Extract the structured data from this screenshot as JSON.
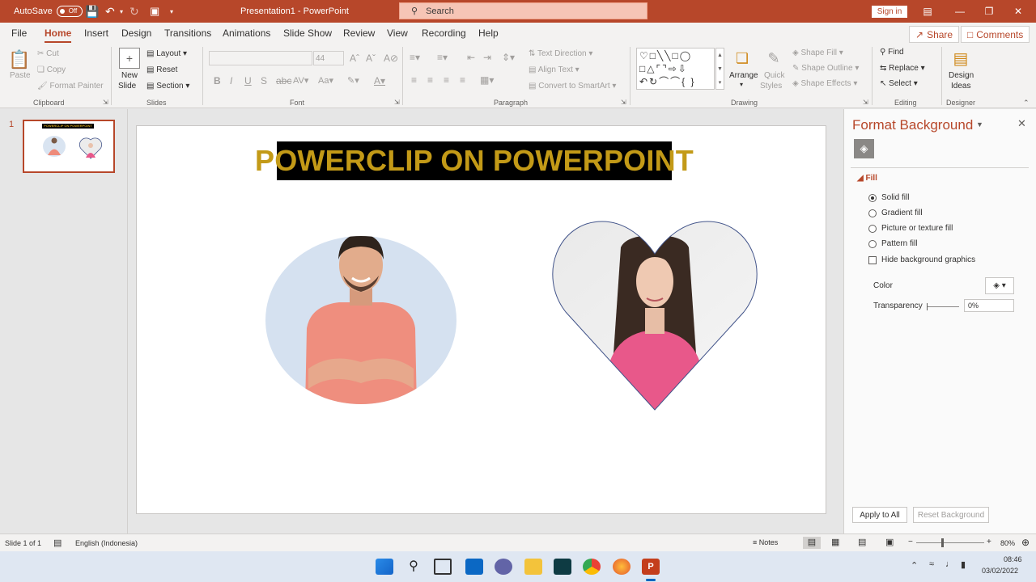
{
  "titlebar": {
    "autosave_label": "AutoSave",
    "autosave_state": "Off",
    "doc_title": "Presentation1 - PowerPoint",
    "search_placeholder": "Search",
    "signin_label": "Sign in",
    "accent": "#b7472a"
  },
  "tabs": [
    "File",
    "Home",
    "Insert",
    "Design",
    "Transitions",
    "Animations",
    "Slide Show",
    "Review",
    "View",
    "Recording",
    "Help"
  ],
  "active_tab": "Home",
  "share_label": "Share",
  "comments_label": "Comments",
  "ribbon": {
    "clipboard": {
      "paste": "Paste",
      "cut": "Cut",
      "copy": "Copy",
      "format_painter": "Format Painter",
      "group": "Clipboard"
    },
    "slides": {
      "new_slide_1": "New",
      "new_slide_2": "Slide",
      "layout": "Layout",
      "reset": "Reset",
      "section": "Section",
      "group": "Slides"
    },
    "font": {
      "size": "44",
      "group": "Font"
    },
    "paragraph": {
      "text_direction": "Text Direction",
      "align_text": "Align Text",
      "convert_smartart": "Convert to SmartArt",
      "group": "Paragraph"
    },
    "drawing": {
      "arrange": "Arrange",
      "quick_styles_1": "Quick",
      "quick_styles_2": "Styles",
      "shape_fill": "Shape Fill",
      "shape_outline": "Shape Outline",
      "shape_effects": "Shape Effects",
      "group": "Drawing"
    },
    "editing": {
      "find": "Find",
      "replace": "Replace",
      "select": "Select",
      "group": "Editing"
    },
    "designer": {
      "design_ideas_1": "Design",
      "design_ideas_2": "Ideas",
      "group": "Designer"
    }
  },
  "slide_panel": {
    "number": "1",
    "thumb_title": "POWERCLIP ON POWERPOINT"
  },
  "slide": {
    "title": "POWERCLIP ON POWERPOINT",
    "title_color": "#c39a17"
  },
  "format_pane": {
    "title": "Format Background",
    "section": "Fill",
    "options": [
      "Solid fill",
      "Gradient fill",
      "Picture or texture fill",
      "Pattern fill"
    ],
    "selected": "Solid fill",
    "hide_bg": "Hide background graphics",
    "color_label": "Color",
    "transparency_label": "Transparency",
    "transparency_value": "0%",
    "apply_all": "Apply to All",
    "reset_bg": "Reset Background"
  },
  "status": {
    "slide_info": "Slide 1 of 1",
    "language": "English (Indonesia)",
    "notes": "Notes",
    "zoom": "80%"
  },
  "taskbar": {
    "time": "08:46",
    "date": "03/02/2022"
  }
}
